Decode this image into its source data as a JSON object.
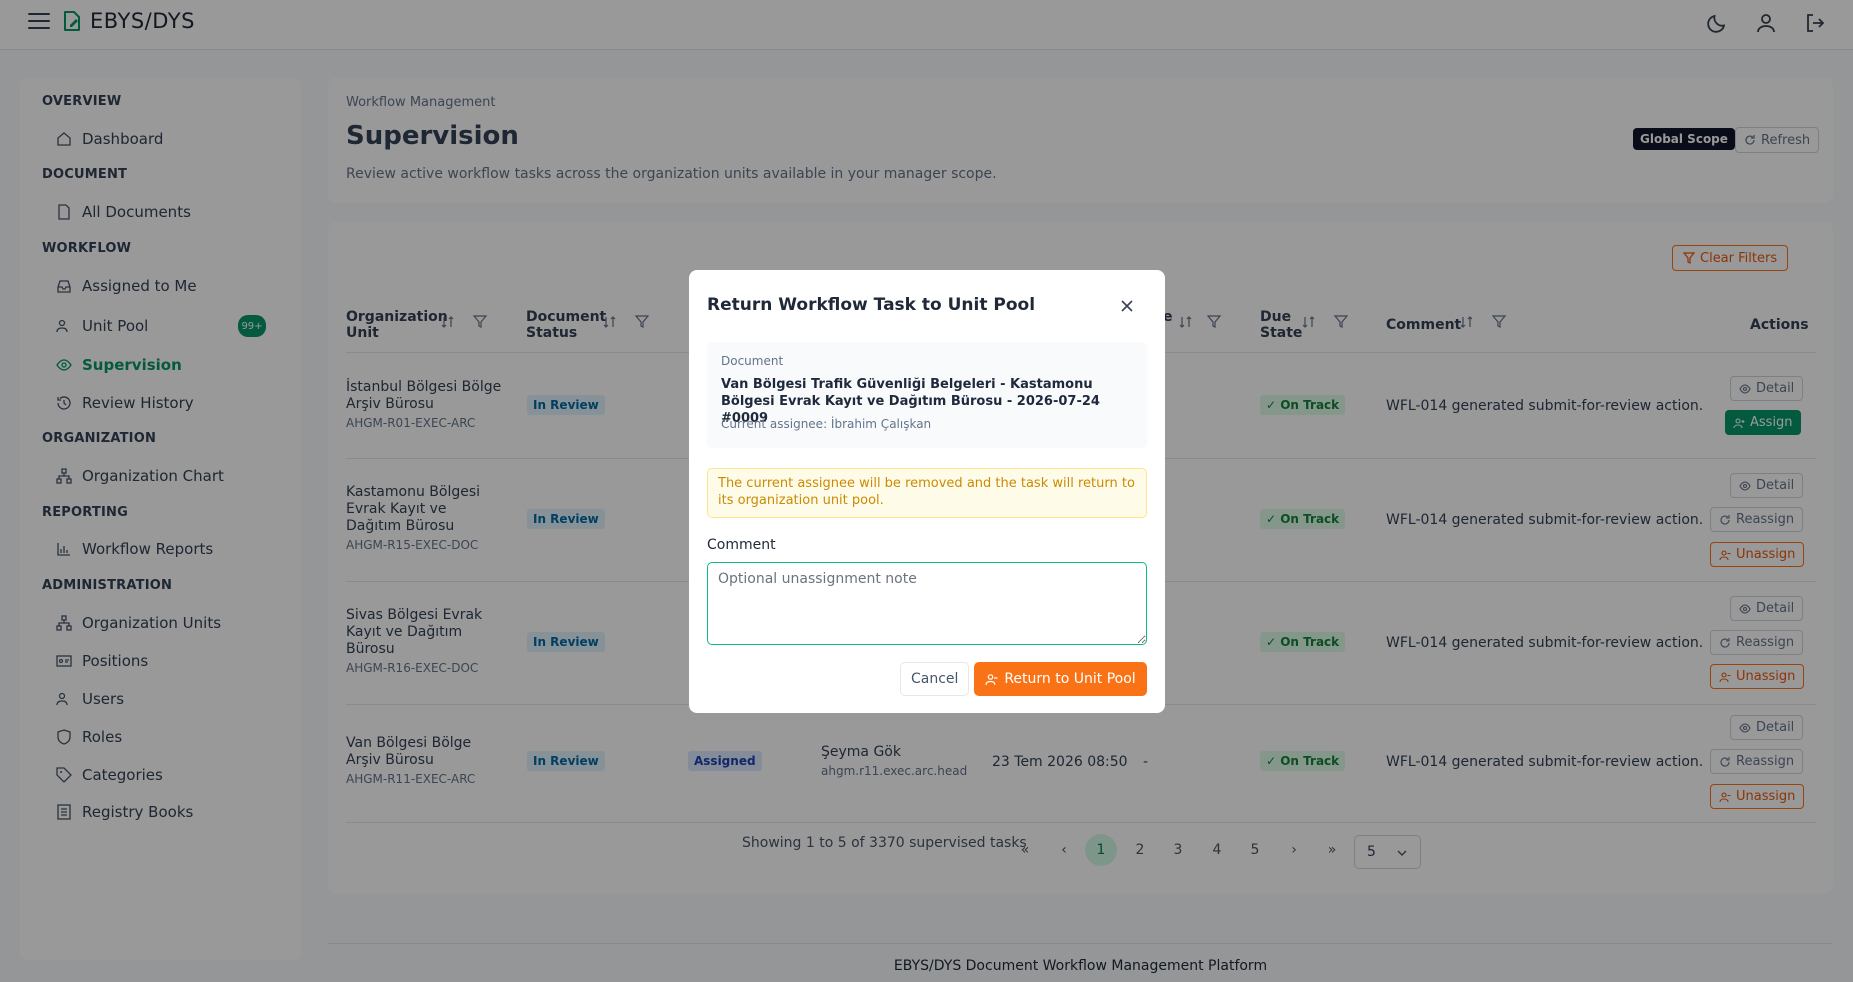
{
  "app": {
    "name": "EBYS/DYS"
  },
  "sidebar": {
    "sections": [
      {
        "title": "OVERVIEW",
        "items": [
          {
            "label": "Dashboard"
          }
        ]
      },
      {
        "title": "DOCUMENT",
        "items": [
          {
            "label": "All Documents"
          }
        ]
      },
      {
        "title": "WORKFLOW",
        "items": [
          {
            "label": "Assigned to Me"
          },
          {
            "label": "Unit Pool",
            "badge": "99+"
          },
          {
            "label": "Supervision"
          },
          {
            "label": "Review History"
          }
        ]
      },
      {
        "title": "ORGANIZATION",
        "items": [
          {
            "label": "Organization Chart"
          }
        ]
      },
      {
        "title": "REPORTING",
        "items": [
          {
            "label": "Workflow Reports"
          }
        ]
      },
      {
        "title": "ADMINISTRATION",
        "items": [
          {
            "label": "Organization Units"
          },
          {
            "label": "Positions"
          },
          {
            "label": "Users"
          },
          {
            "label": "Roles"
          },
          {
            "label": "Categories"
          },
          {
            "label": "Registry Books"
          }
        ]
      }
    ],
    "active": "Supervision"
  },
  "header": {
    "breadcrumb": "Workflow Management",
    "title": "Supervision",
    "description": "Review active workflow tasks across the organization units available in your manager scope.",
    "scope_badge": "Global Scope",
    "refresh_label": "Refresh"
  },
  "table": {
    "clear_filters": "Clear Filters",
    "columns": {
      "org_unit": "Organization Unit",
      "doc_status": "Document Status",
      "partial_header": "e",
      "due_state": "Due State",
      "comment": "Comment",
      "actions": "Actions"
    },
    "rows": [
      {
        "unit": "İstanbul Bölgesi Bölge Arşiv Bürosu",
        "code": "AHGM-R01-EXEC-ARC",
        "status": "In Review",
        "due": "On Track",
        "comment": "WFL-014 generated submit-for-review action.",
        "actions": [
          "Detail",
          "Assign"
        ]
      },
      {
        "unit": "Kastamonu Bölgesi Evrak Kayıt ve Dağıtım Bürosu",
        "code": "AHGM-R15-EXEC-DOC",
        "status": "In Review",
        "due": "On Track",
        "comment": "WFL-014 generated submit-for-review action.",
        "actions": [
          "Detail",
          "Reassign",
          "Unassign"
        ]
      },
      {
        "unit": "Sivas Bölgesi Evrak Kayıt ve Dağıtım Bürosu",
        "code": "AHGM-R16-EXEC-DOC",
        "status": "In Review",
        "due": "On Track",
        "comment": "WFL-014 generated submit-for-review action.",
        "actions": [
          "Detail",
          "Reassign",
          "Unassign"
        ]
      },
      {
        "unit": "Van Bölgesi Bölge Arşiv Bürosu",
        "code": "AHGM-R11-EXEC-ARC",
        "status": "In Review",
        "task_status": "Assigned",
        "assignee": "Şeyma Gök",
        "assignee_user": "ahgm.r11.exec.arc.head",
        "date": "23 Tem 2026 08:50",
        "dash": "-",
        "due": "On Track",
        "comment": "WFL-014 generated submit-for-review action.",
        "actions": [
          "Detail",
          "Reassign",
          "Unassign"
        ]
      }
    ]
  },
  "pagination": {
    "summary": "Showing 1 to 5 of 3370 supervised tasks",
    "pages": [
      "1",
      "2",
      "3",
      "4",
      "5"
    ],
    "current": "1",
    "first": "«",
    "prev": "‹",
    "next": "›",
    "last": "»",
    "page_size": "5"
  },
  "footer": {
    "text": "EBYS/DYS Document Workflow Management Platform"
  },
  "modal": {
    "title": "Return Workflow Task to Unit Pool",
    "doc_label": "Document",
    "doc_name": "Van Bölgesi Trafik Güvenliği Belgeleri - Kastamonu Bölgesi Evrak Kayıt ve Dağıtım Bürosu - 2026-07-24 #0009",
    "current_assignee": "Current assignee: İbrahim Çalışkan",
    "warning": "The current assignee will be removed and the task will return to its organization unit pool.",
    "comment_label": "Comment",
    "comment_placeholder": "Optional unassignment note",
    "comment_value": "",
    "cancel": "Cancel",
    "confirm": "Return to Unit Pool"
  },
  "colors": {
    "accent": "#059669",
    "warning": "#f97316",
    "dark": "#0f172a"
  }
}
